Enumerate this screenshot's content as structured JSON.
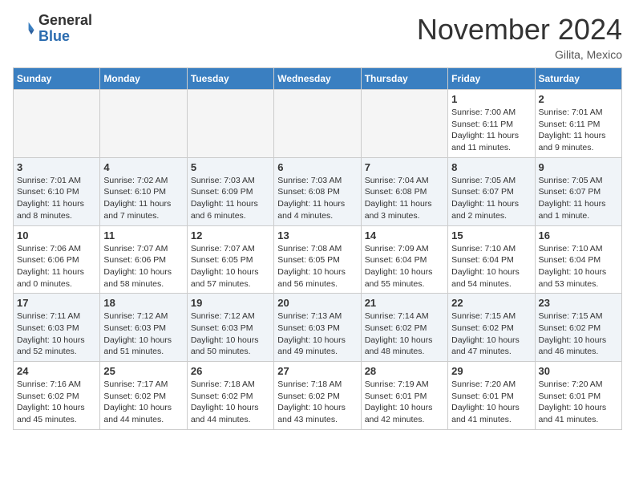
{
  "header": {
    "logo_general": "General",
    "logo_blue": "Blue",
    "month_title": "November 2024",
    "location": "Gilita, Mexico"
  },
  "days_of_week": [
    "Sunday",
    "Monday",
    "Tuesday",
    "Wednesday",
    "Thursday",
    "Friday",
    "Saturday"
  ],
  "weeks": [
    [
      {
        "day": "",
        "info": ""
      },
      {
        "day": "",
        "info": ""
      },
      {
        "day": "",
        "info": ""
      },
      {
        "day": "",
        "info": ""
      },
      {
        "day": "",
        "info": ""
      },
      {
        "day": "1",
        "info": "Sunrise: 7:00 AM\nSunset: 6:11 PM\nDaylight: 11 hours and 11 minutes."
      },
      {
        "day": "2",
        "info": "Sunrise: 7:01 AM\nSunset: 6:11 PM\nDaylight: 11 hours and 9 minutes."
      }
    ],
    [
      {
        "day": "3",
        "info": "Sunrise: 7:01 AM\nSunset: 6:10 PM\nDaylight: 11 hours and 8 minutes."
      },
      {
        "day": "4",
        "info": "Sunrise: 7:02 AM\nSunset: 6:10 PM\nDaylight: 11 hours and 7 minutes."
      },
      {
        "day": "5",
        "info": "Sunrise: 7:03 AM\nSunset: 6:09 PM\nDaylight: 11 hours and 6 minutes."
      },
      {
        "day": "6",
        "info": "Sunrise: 7:03 AM\nSunset: 6:08 PM\nDaylight: 11 hours and 4 minutes."
      },
      {
        "day": "7",
        "info": "Sunrise: 7:04 AM\nSunset: 6:08 PM\nDaylight: 11 hours and 3 minutes."
      },
      {
        "day": "8",
        "info": "Sunrise: 7:05 AM\nSunset: 6:07 PM\nDaylight: 11 hours and 2 minutes."
      },
      {
        "day": "9",
        "info": "Sunrise: 7:05 AM\nSunset: 6:07 PM\nDaylight: 11 hours and 1 minute."
      }
    ],
    [
      {
        "day": "10",
        "info": "Sunrise: 7:06 AM\nSunset: 6:06 PM\nDaylight: 11 hours and 0 minutes."
      },
      {
        "day": "11",
        "info": "Sunrise: 7:07 AM\nSunset: 6:06 PM\nDaylight: 10 hours and 58 minutes."
      },
      {
        "day": "12",
        "info": "Sunrise: 7:07 AM\nSunset: 6:05 PM\nDaylight: 10 hours and 57 minutes."
      },
      {
        "day": "13",
        "info": "Sunrise: 7:08 AM\nSunset: 6:05 PM\nDaylight: 10 hours and 56 minutes."
      },
      {
        "day": "14",
        "info": "Sunrise: 7:09 AM\nSunset: 6:04 PM\nDaylight: 10 hours and 55 minutes."
      },
      {
        "day": "15",
        "info": "Sunrise: 7:10 AM\nSunset: 6:04 PM\nDaylight: 10 hours and 54 minutes."
      },
      {
        "day": "16",
        "info": "Sunrise: 7:10 AM\nSunset: 6:04 PM\nDaylight: 10 hours and 53 minutes."
      }
    ],
    [
      {
        "day": "17",
        "info": "Sunrise: 7:11 AM\nSunset: 6:03 PM\nDaylight: 10 hours and 52 minutes."
      },
      {
        "day": "18",
        "info": "Sunrise: 7:12 AM\nSunset: 6:03 PM\nDaylight: 10 hours and 51 minutes."
      },
      {
        "day": "19",
        "info": "Sunrise: 7:12 AM\nSunset: 6:03 PM\nDaylight: 10 hours and 50 minutes."
      },
      {
        "day": "20",
        "info": "Sunrise: 7:13 AM\nSunset: 6:03 PM\nDaylight: 10 hours and 49 minutes."
      },
      {
        "day": "21",
        "info": "Sunrise: 7:14 AM\nSunset: 6:02 PM\nDaylight: 10 hours and 48 minutes."
      },
      {
        "day": "22",
        "info": "Sunrise: 7:15 AM\nSunset: 6:02 PM\nDaylight: 10 hours and 47 minutes."
      },
      {
        "day": "23",
        "info": "Sunrise: 7:15 AM\nSunset: 6:02 PM\nDaylight: 10 hours and 46 minutes."
      }
    ],
    [
      {
        "day": "24",
        "info": "Sunrise: 7:16 AM\nSunset: 6:02 PM\nDaylight: 10 hours and 45 minutes."
      },
      {
        "day": "25",
        "info": "Sunrise: 7:17 AM\nSunset: 6:02 PM\nDaylight: 10 hours and 44 minutes."
      },
      {
        "day": "26",
        "info": "Sunrise: 7:18 AM\nSunset: 6:02 PM\nDaylight: 10 hours and 44 minutes."
      },
      {
        "day": "27",
        "info": "Sunrise: 7:18 AM\nSunset: 6:02 PM\nDaylight: 10 hours and 43 minutes."
      },
      {
        "day": "28",
        "info": "Sunrise: 7:19 AM\nSunset: 6:01 PM\nDaylight: 10 hours and 42 minutes."
      },
      {
        "day": "29",
        "info": "Sunrise: 7:20 AM\nSunset: 6:01 PM\nDaylight: 10 hours and 41 minutes."
      },
      {
        "day": "30",
        "info": "Sunrise: 7:20 AM\nSunset: 6:01 PM\nDaylight: 10 hours and 41 minutes."
      }
    ]
  ]
}
